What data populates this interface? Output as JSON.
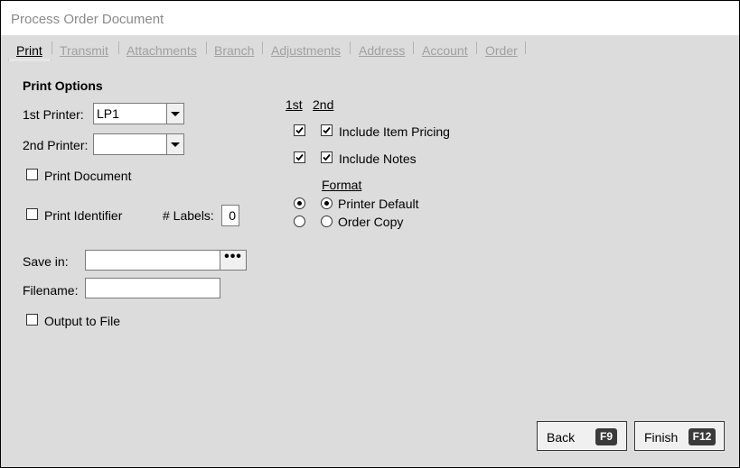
{
  "window": {
    "title": "Process Order Document"
  },
  "tabs": [
    {
      "label": "Print"
    },
    {
      "label": "Transmit"
    },
    {
      "label": "Attachments"
    },
    {
      "label": "Branch"
    },
    {
      "label": "Adjustments"
    },
    {
      "label": "Address"
    },
    {
      "label": "Account"
    },
    {
      "label": "Order"
    }
  ],
  "print_options": {
    "title": "Print Options",
    "first_printer_label": "1st Printer:",
    "first_printer_value": "LP1",
    "second_printer_label": "2nd Printer:",
    "second_printer_value": "",
    "print_document_label": "Print Document",
    "print_document_checked": false,
    "print_identifier_label": "Print Identifier",
    "print_identifier_checked": false,
    "labels_label": "# Labels:",
    "labels_value": "0",
    "save_in_label": "Save in:",
    "save_in_value": "",
    "browse_label": "•••",
    "filename_label": "Filename:",
    "filename_value": "",
    "output_to_file_label": "Output to File",
    "output_to_file_checked": false
  },
  "printer_columns": {
    "first_header": "1st",
    "second_header": "2nd",
    "include_item_pricing_label": "Include Item Pricing",
    "include_item_pricing_1st": true,
    "include_item_pricing_2nd": true,
    "include_notes_label": "Include Notes",
    "include_notes_1st": true,
    "include_notes_2nd": true,
    "format_title": "Format",
    "printer_default_label": "Printer Default",
    "printer_default_1st": true,
    "printer_default_2nd": true,
    "order_copy_label": "Order Copy",
    "order_copy_1st": false,
    "order_copy_2nd": false
  },
  "footer": {
    "back_label": "Back",
    "back_key": "F9",
    "finish_label": "Finish",
    "finish_key": "F12"
  },
  "colors": {
    "window_bg": "#dcdcdc",
    "title_text": "#8a8a8a",
    "disabled_tab": "#a0a0a0",
    "key_badge": "#3a3a3a"
  }
}
